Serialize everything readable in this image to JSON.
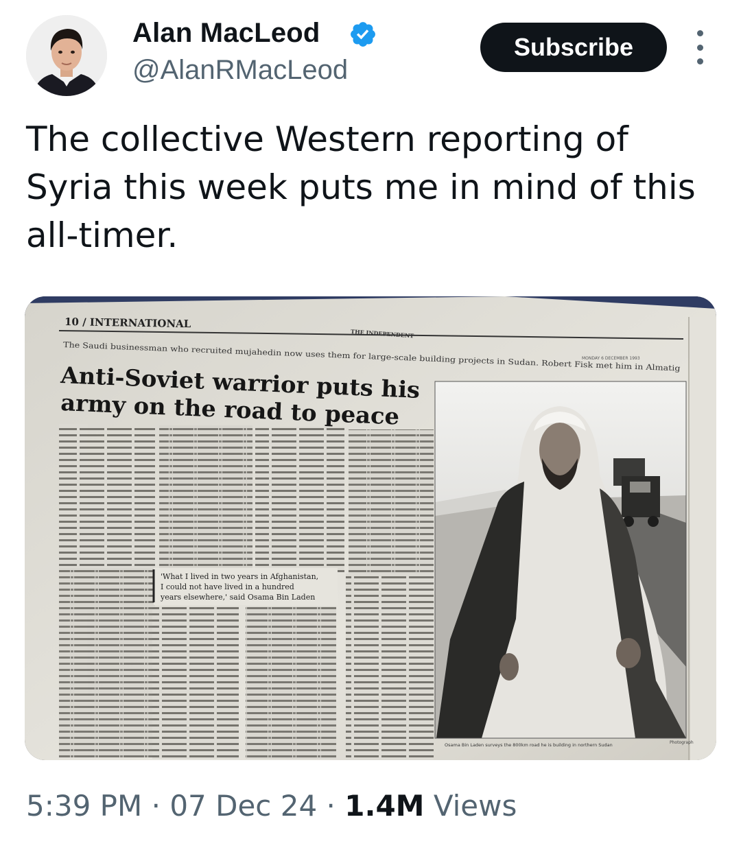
{
  "author": {
    "name": "Alan MacLeod",
    "handle": "@AlanRMacLeod",
    "verified": true
  },
  "actions": {
    "subscribe_label": "Subscribe",
    "more_icon": "more-vertical-icon"
  },
  "tweet": {
    "lines": [
      "The collective Western reporting of",
      "Syria this week puts me in mind of this",
      "all-timer."
    ]
  },
  "media": {
    "section": "10 / INTERNATIONAL",
    "masthead": "THE INDEPENDENT",
    "date": "MONDAY 6 DECEMBER 1993",
    "standfirst": "The Saudi businessman who recruited mujahedin now uses them for large-scale building projects in Sudan. Robert Fisk met him in Almatig",
    "headline_line1": "Anti-Soviet warrior puts his",
    "headline_line2": "army on the road to peace",
    "pull_quote_line1": "'What I lived in two years in Afghanistan,",
    "pull_quote_line2": "I could not have lived in a hundred",
    "pull_quote_line3": "years elsewhere,' said Osama Bin Laden",
    "caption": "Osama Bin Laden surveys the 800km road he is building in northern Sudan",
    "photo_credit": "Photograph"
  },
  "meta": {
    "time": "5:39 PM",
    "date": "07 Dec 24",
    "views_count": "1.4M",
    "views_label": "Views",
    "separator": "·"
  },
  "colors": {
    "text": "#0f1419",
    "secondary": "#536471",
    "verified": "#1d9bf0",
    "button": "#0f1419"
  }
}
